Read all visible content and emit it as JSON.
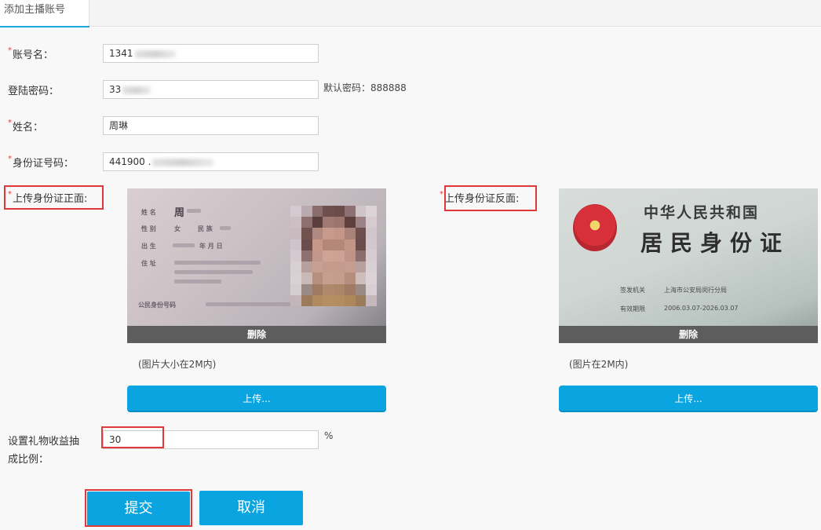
{
  "tab": {
    "title": "添加主播账号"
  },
  "form": {
    "required_mark": "*",
    "account": {
      "label": "账号名：",
      "value": "1341"
    },
    "password": {
      "label": "登陆密码：",
      "value": "33",
      "hint": "默认密码：888888"
    },
    "name": {
      "label": "姓名：",
      "value": "周琳"
    },
    "id_number": {
      "label": "身份证号码：",
      "value": "441900 ."
    },
    "id_front": {
      "label": "上传身份证正面:",
      "delete_label": "删除",
      "size_hint": "(图片大小在2M内)",
      "upload_label": "上传..."
    },
    "id_back": {
      "label": "上传身份证反面:",
      "delete_label": "删除",
      "size_hint": "(图片在2M内)",
      "upload_label": "上传..."
    },
    "gift_ratio": {
      "label_line1": "设置礼物收益抽",
      "label_line2": "成比例：",
      "value": "30",
      "unit": "%"
    }
  },
  "actions": {
    "submit_label": "提交",
    "cancel_label": "取消"
  },
  "id_card_front": {
    "fields": [
      "姓 名",
      "性 别",
      "出 生",
      "住 址",
      "公民身份号码"
    ],
    "name_char": "周",
    "gender": "女",
    "ethnicity": "民 族",
    "birth": "年 月 日"
  },
  "id_card_back": {
    "country": "中华人民共和国",
    "title": "居民身份证",
    "authority_label": "签发机关",
    "authority_value": "上海市公安局闵行分局",
    "validity_label": "有效期限",
    "validity_value": "2006.03.07-2026.03.07"
  },
  "colors": {
    "accent": "#0aa4e0",
    "highlight": "#e0393b",
    "required": "#e04040"
  }
}
